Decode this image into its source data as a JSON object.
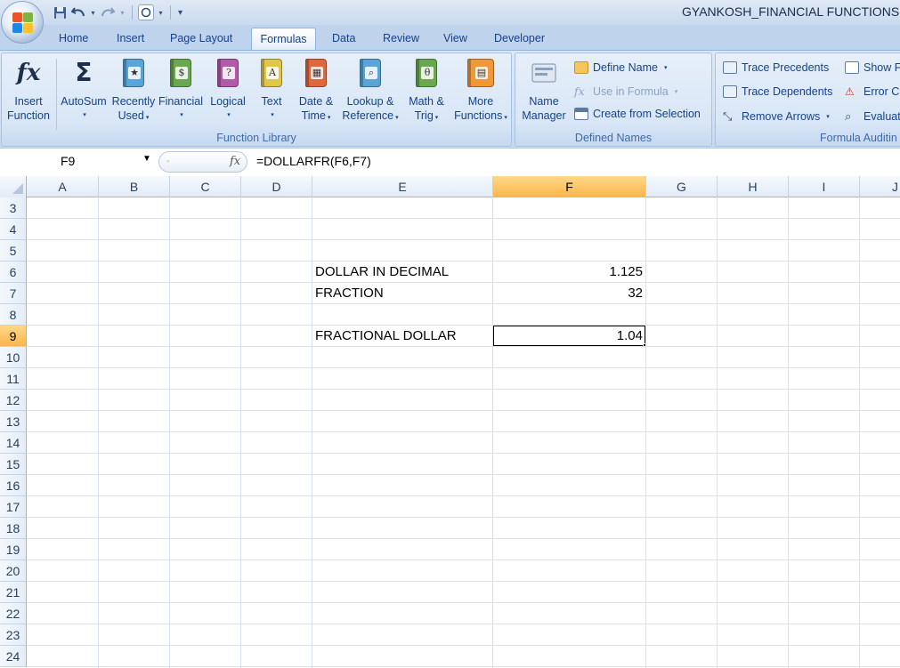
{
  "window": {
    "title": "GYANKOSH_FINANCIAL FUNCTIONS.x"
  },
  "quick_access": {
    "save": "save-icon",
    "undo": "undo-icon",
    "redo": "redo-icon",
    "customize": "customize-icon"
  },
  "tabs": [
    "Home",
    "Insert",
    "Page Layout",
    "Formulas",
    "Data",
    "Review",
    "View",
    "Developer"
  ],
  "active_tab": "Formulas",
  "ribbon": {
    "function_library": {
      "label": "Function Library",
      "insert_function": [
        "Insert",
        "Function"
      ],
      "autosum": [
        "AutoSum",
        ""
      ],
      "recently_used": [
        "Recently",
        "Used"
      ],
      "financial": [
        "Financial",
        ""
      ],
      "logical": [
        "Logical",
        ""
      ],
      "text": [
        "Text",
        ""
      ],
      "date_time": [
        "Date &",
        "Time"
      ],
      "lookup": [
        "Lookup &",
        "Reference"
      ],
      "math": [
        "Math &",
        "Trig"
      ],
      "more": [
        "More",
        "Functions"
      ]
    },
    "defined_names": {
      "label": "Defined Names",
      "name_manager": [
        "Name",
        "Manager"
      ],
      "define_name": "Define Name",
      "use_in_formula": "Use in Formula",
      "create_from_selection": "Create from Selection"
    },
    "formula_auditing": {
      "label": "Formula Auditin",
      "trace_precedents": "Trace Precedents",
      "trace_dependents": "Trace Dependents",
      "remove_arrows": "Remove Arrows",
      "show_formulas": "Show F",
      "error_checking": "Error C",
      "evaluate": "Evaluat"
    }
  },
  "formula_bar": {
    "name_box": "F9",
    "fx": "fx",
    "formula": "=DOLLARFR(F6,F7)"
  },
  "grid": {
    "columns": [
      "A",
      "B",
      "C",
      "D",
      "E",
      "F",
      "G",
      "H",
      "I",
      "J"
    ],
    "selected_column": "F",
    "rows": [
      "3",
      "4",
      "5",
      "6",
      "7",
      "8",
      "9",
      "10",
      "11",
      "12",
      "13",
      "14",
      "15",
      "16",
      "17",
      "18",
      "19",
      "20",
      "21",
      "22",
      "23",
      "24"
    ],
    "selected_row": "9",
    "cells": {
      "E6": "DOLLAR IN DECIMAL",
      "F6": "1.125",
      "E7": "FRACTION",
      "F7": "32",
      "E9": "FRACTIONAL DOLLAR",
      "F9": "1.04"
    }
  },
  "colors": {
    "ribbon_bg": "#d3e2f5",
    "tab_text": "#15428b",
    "selected_header": "#f9b54b",
    "grid_line": "#dae2ec"
  }
}
